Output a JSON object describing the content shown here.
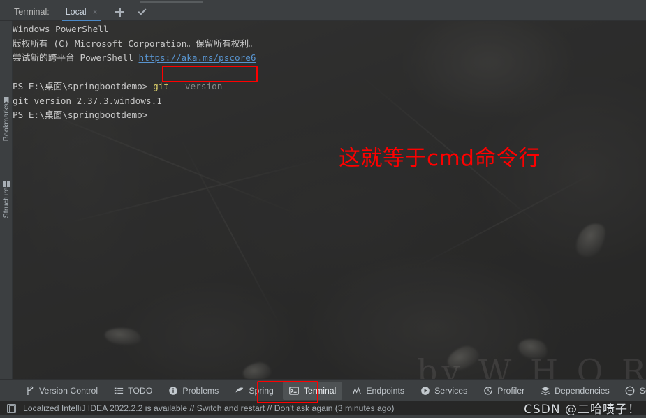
{
  "window": {
    "terminal_label": "Terminal:",
    "tabs": [
      {
        "name": "Local",
        "close_glyph": "×"
      }
    ],
    "add_tab_icon": "plus-icon",
    "tab_options_icon": "chevron-down-icon"
  },
  "terminal": {
    "lines": [
      {
        "segments": [
          {
            "text": "Windows PowerShell",
            "style": "plain"
          }
        ]
      },
      {
        "segments": [
          {
            "text": "版权所有 (C) Microsoft Corporation。保留所有权利。",
            "style": "plain"
          }
        ]
      },
      {
        "segments": [
          {
            "text": "尝试新的跨平台 PowerShell ",
            "style": "plain"
          },
          {
            "text": "https://aka.ms/pscore6",
            "style": "link"
          }
        ]
      },
      {
        "segments": [
          {
            "text": "",
            "style": "plain"
          }
        ]
      },
      {
        "segments": [
          {
            "text": "PS E:\\桌面\\springbootdemo> ",
            "style": "plain"
          },
          {
            "text": "git",
            "style": "cmd"
          },
          {
            "text": " --version",
            "style": "arg"
          }
        ]
      },
      {
        "segments": [
          {
            "text": "git version 2.37.3.windows.1",
            "style": "plain"
          }
        ]
      },
      {
        "segments": [
          {
            "text": "PS E:\\桌面\\springbootdemo>",
            "style": "plain"
          }
        ]
      }
    ],
    "command_highlight": "git --version"
  },
  "annotation": {
    "text": "这就等于cmd命令行",
    "color": "#ff0000"
  },
  "background_watermark": "by  W H O R",
  "left_sidebar": {
    "items": [
      {
        "label": "Bookmarks",
        "icon": "bookmark-icon"
      },
      {
        "label": "Structure",
        "icon": "structure-icon"
      }
    ]
  },
  "tool_window_bar": {
    "items": [
      {
        "label": "Version Control",
        "icon": "git-branch-icon",
        "active": false
      },
      {
        "label": "TODO",
        "icon": "list-icon",
        "active": false
      },
      {
        "label": "Problems",
        "icon": "info-circle-icon",
        "active": false
      },
      {
        "label": "Spring",
        "icon": "spring-leaf-icon",
        "active": false
      },
      {
        "label": "Terminal",
        "icon": "terminal-icon",
        "active": true
      },
      {
        "label": "Endpoints",
        "icon": "endpoints-icon",
        "active": false
      },
      {
        "label": "Services",
        "icon": "play-circle-icon",
        "active": false
      },
      {
        "label": "Profiler",
        "icon": "profiler-icon",
        "active": false
      },
      {
        "label": "Dependencies",
        "icon": "layers-icon",
        "active": false
      },
      {
        "label": "SonarLint",
        "icon": "sonarlint-icon",
        "active": false
      }
    ],
    "highlight_color": "#fe0000"
  },
  "status_bar": {
    "icon": "window-icon",
    "text": "Localized IntelliJ IDEA 2022.2.2 is available // Switch and restart // Don't ask again (3 minutes ago)"
  },
  "watermark": {
    "text": "CSDN @二哈啧子！"
  },
  "colors": {
    "accent_blue": "#4a88c7",
    "link_blue": "#5894cf",
    "command_yellow": "#ddd06a",
    "annotation_red": "#ff0000",
    "panel_bg": "#3c3f41",
    "terminal_bg": "#2b2b2b"
  }
}
